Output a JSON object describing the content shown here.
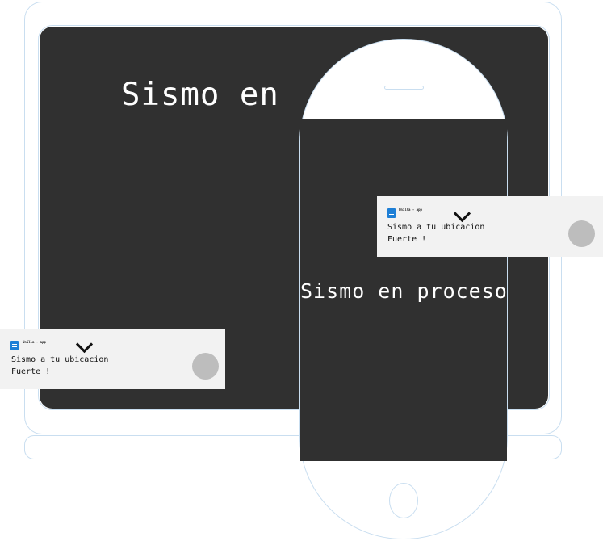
{
  "laptop": {
    "headline": "Sismo en"
  },
  "phone": {
    "headline": "Sismo en proceso"
  },
  "notifications": [
    {
      "app_name": "Unilla - app",
      "title": "Sismo a tu ubicacion",
      "subtitle": "Fuerte !",
      "icon": "document-icon",
      "chevron": "chevron-down-icon"
    },
    {
      "app_name": "Unilla - app",
      "title": "Sismo a tu ubicacion",
      "subtitle": "Fuerte !",
      "icon": "document-icon",
      "chevron": "chevron-down-icon"
    }
  ],
  "colors": {
    "screen_bg": "#303030",
    "outline": "#c9def0",
    "notification_bg": "#f2f2f2",
    "app_icon": "#1e7fd6",
    "toggle": "#bdbdbd"
  }
}
